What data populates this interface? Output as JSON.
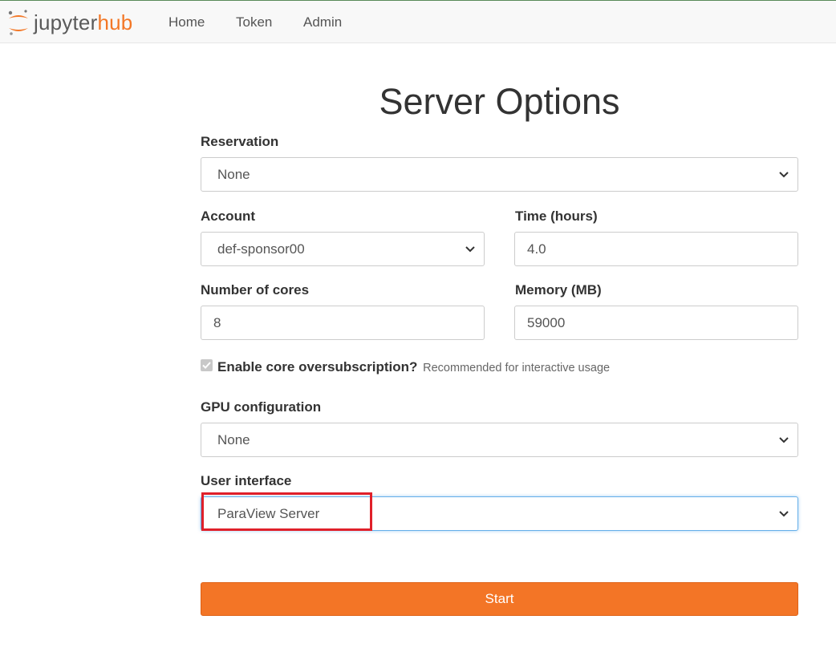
{
  "brand": {
    "text_jupyter": "jupyter",
    "text_hub": "hub",
    "accent": "#f37726"
  },
  "nav": {
    "items": [
      {
        "label": "Home"
      },
      {
        "label": "Token"
      },
      {
        "label": "Admin"
      }
    ]
  },
  "page": {
    "title": "Server Options"
  },
  "form": {
    "reservation": {
      "label": "Reservation",
      "value": "None"
    },
    "account": {
      "label": "Account",
      "value": "def-sponsor00"
    },
    "time": {
      "label": "Time (hours)",
      "value": "4.0"
    },
    "cores": {
      "label": "Number of cores",
      "value": "8"
    },
    "memory": {
      "label": "Memory (MB)",
      "value": "59000"
    },
    "oversubscription": {
      "label": "Enable core oversubscription?",
      "hint": "Recommended for interactive usage",
      "checked": true
    },
    "gpu": {
      "label": "GPU configuration",
      "value": "None"
    },
    "ui": {
      "label": "User interface",
      "value": "ParaView Server"
    },
    "start_label": "Start"
  },
  "colors": {
    "start_button": "#f37526",
    "highlight": "#e0202a",
    "focus": "#66afe9"
  }
}
